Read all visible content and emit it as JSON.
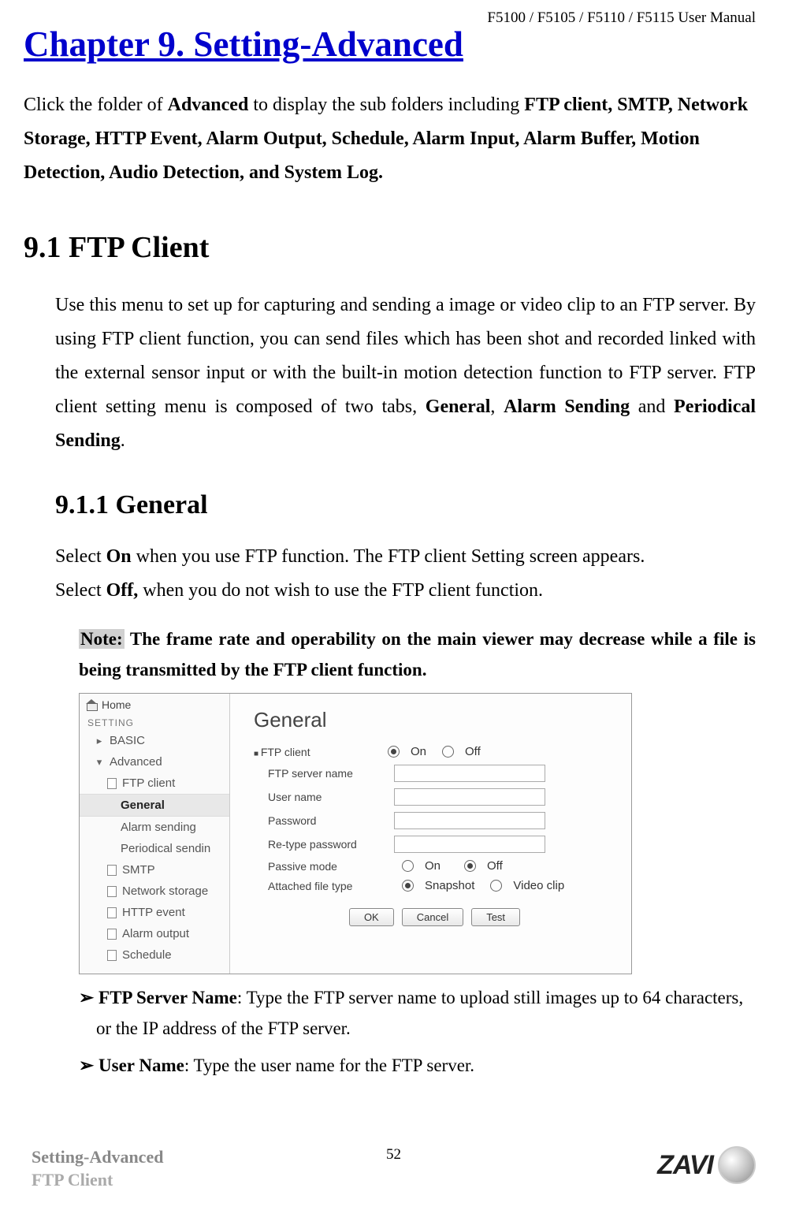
{
  "header": {
    "manual_title": "F5100 / F5105 / F5110 / F5115 User Manual"
  },
  "chapter": {
    "title": "Chapter 9. Setting-Advanced"
  },
  "intro": {
    "pre": "Click the folder of ",
    "b1": "Advanced",
    "mid": " to display the sub folders including ",
    "b2": "FTP client, SMTP, Network Storage, HTTP Event, Alarm Output, Schedule, Alarm Input, Alarm Buffer, Motion Detection, Audio Detection, and System Log."
  },
  "section": {
    "num_title": "9.1 FTP Client",
    "para_pre": "Use this menu to set up for capturing and sending a image or video clip to an FTP server. By using FTP client function, you can send files which has been shot and recorded linked with the external sensor input or with the built-in motion detection function to FTP server. FTP client setting menu is composed of two tabs, ",
    "b1": "General",
    "sep1": ", ",
    "b2": "Alarm Sending",
    "sep2": " and ",
    "b3": "Periodical Sending",
    "after": "."
  },
  "subsection": {
    "title": "9.1.1 General",
    "line1_pre": "Select ",
    "line1_b": "On",
    "line1_post": " when you use FTP function. The FTP client Setting screen appears.",
    "line2_pre": "Select ",
    "line2_b": "Off,",
    "line2_post": " when you do not wish to use the FTP client function."
  },
  "note": {
    "label": "Note:",
    "text": " The frame rate and operability on the main viewer may decrease while a file is being transmitted by the FTP client function."
  },
  "screenshot": {
    "home": "Home",
    "setting_label": "SETTING",
    "tree": {
      "basic": "BASIC",
      "advanced": "Advanced",
      "ftp": "FTP client",
      "general": "General",
      "alarm_sending": "Alarm sending",
      "periodical": "Periodical sendin",
      "smtp": "SMTP",
      "network_storage": "Network storage",
      "http_event": "HTTP event",
      "alarm_output": "Alarm output",
      "schedule": "Schedule"
    },
    "panel": {
      "title": "General",
      "ftp_client_label": "FTP client",
      "on": "On",
      "off": "Off",
      "server_name": "FTP server name",
      "user_name": "User name",
      "password": "Password",
      "retype_password": "Re-type password",
      "passive_mode": "Passive mode",
      "attached_file": "Attached file type",
      "snapshot": "Snapshot",
      "video_clip": "Video clip",
      "ok": "OK",
      "cancel": "Cancel",
      "test": "Test"
    }
  },
  "bullets": {
    "b1_label": "FTP Server Name",
    "b1_text": ": Type the FTP server name to upload still images up to 64 characters, or the IP address of the FTP server.",
    "b2_label": "User Name",
    "b2_text": ": Type the user name for the FTP server."
  },
  "footer": {
    "left_line1": "Setting-Advanced",
    "left_line2": "FTP Client",
    "page": "52",
    "logo_text": "ZAVI"
  }
}
